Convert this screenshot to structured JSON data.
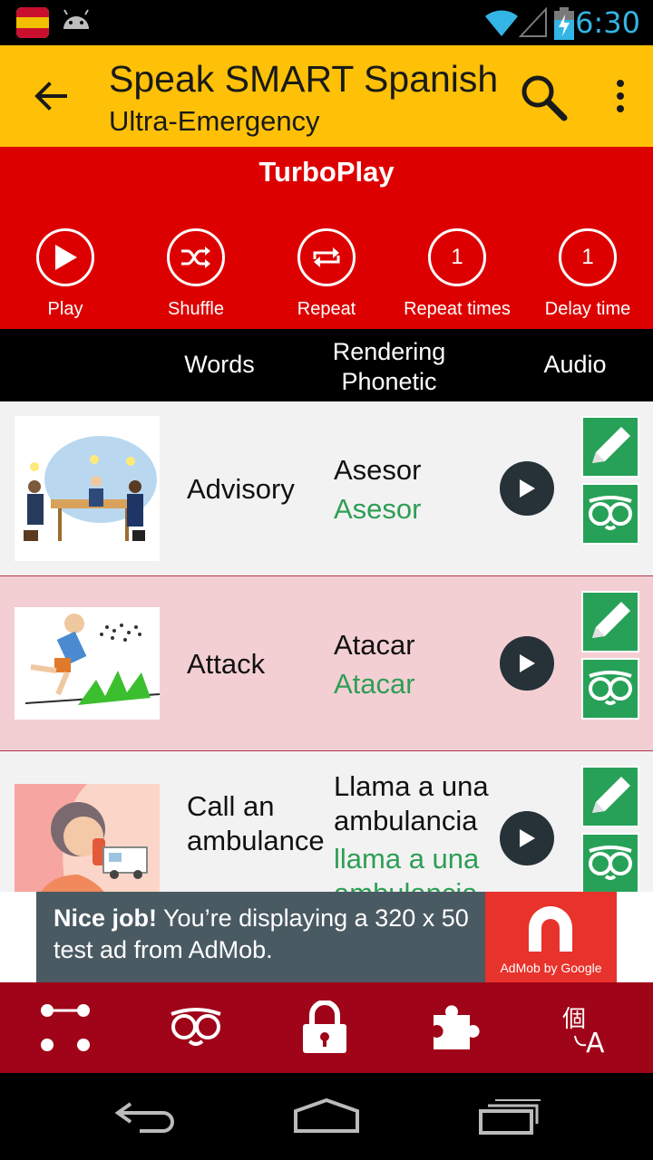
{
  "status_bar": {
    "time": "6:30"
  },
  "app_bar": {
    "title": "Speak SMART Spanish",
    "subtitle": "Ultra-Emergency"
  },
  "turboplay": {
    "heading": "TurboPlay",
    "controls": [
      {
        "label": "Play",
        "icon": "play-icon"
      },
      {
        "label": "Shuffle",
        "icon": "shuffle-icon"
      },
      {
        "label": "Repeat",
        "icon": "repeat-icon"
      },
      {
        "label": "Repeat times",
        "value": "1"
      },
      {
        "label": "Delay time",
        "value": "1"
      }
    ]
  },
  "columns": {
    "words": "Words",
    "rendering_line1": "Rendering",
    "rendering_line2": "Phonetic",
    "audio": "Audio"
  },
  "rows": [
    {
      "word": "Advisory",
      "rendering": "Asesor",
      "phonetic": "Asesor",
      "background": "#f2f2f2",
      "image": "business-meeting-image"
    },
    {
      "word": "Attack",
      "rendering": "Atacar",
      "phonetic": "Atacar",
      "background": "#f3cfd4",
      "image": "man-running-from-bees-image"
    },
    {
      "word": "Call an ambulance",
      "rendering": "Llama a una ambulancia",
      "phonetic": "llama a una ambulancia",
      "background": "#f2f2f2",
      "image": "woman-on-phone-ambulance-image"
    }
  ],
  "ad": {
    "headline": "Nice job!",
    "body": "You’re displaying a 320 x 50 test ad from AdMob.",
    "brand": "AdMob by Google"
  },
  "bottom_bar": {
    "items": [
      "dots-grid-icon",
      "owl-icon",
      "lock-icon",
      "puzzle-icon",
      "translate-icon"
    ]
  },
  "colors": {
    "app_bar": "#fec107",
    "turbo": "#dd0000",
    "phonetic": "#2e9e55",
    "action_green": "#27a158",
    "bottom_bar": "#a00418"
  }
}
